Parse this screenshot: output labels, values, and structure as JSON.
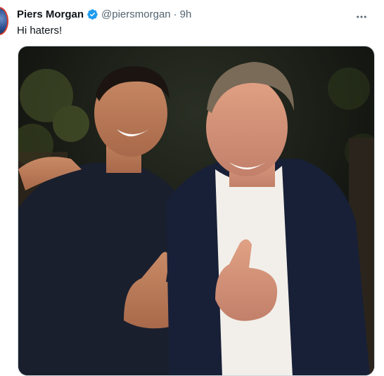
{
  "tweet": {
    "author_name": "Piers Morgan",
    "handle": "@piersmorgan",
    "separator": "·",
    "time": "9h",
    "text": "Hi haters!",
    "verified": true,
    "more_icon": "more-horizontal-icon",
    "verified_icon": "verified-badge-icon"
  },
  "colors": {
    "verified_blue": "#1d9bf0",
    "secondary_text": "#536471"
  }
}
